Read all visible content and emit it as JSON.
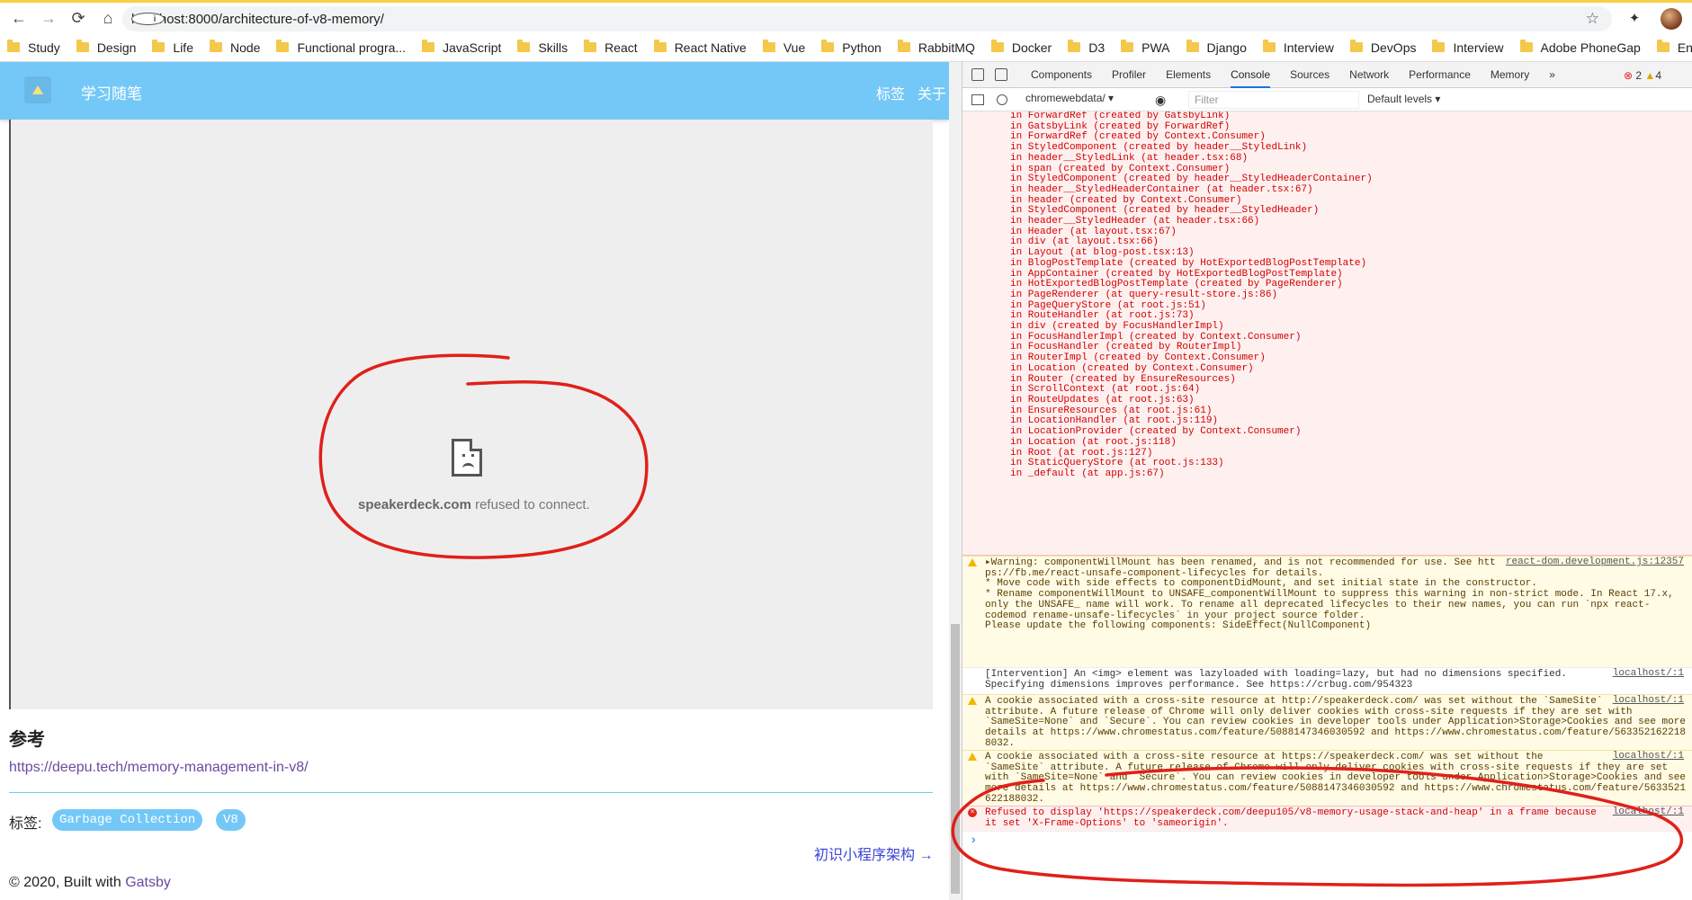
{
  "browser": {
    "url": "localhost:8000/architecture-of-v8-memory/",
    "nav_icons": [
      "back-arrow-icon",
      "forward-arrow-icon",
      "reload-icon",
      "home-icon"
    ],
    "bookmarks": [
      "Study",
      "Design",
      "Life",
      "Node",
      "Functional progra...",
      "JavaScript",
      "Skills",
      "React",
      "React Native",
      "Vue",
      "Python",
      "RabbitMQ",
      "Docker",
      "D3",
      "PWA",
      "Django",
      "Interview",
      "DevOps",
      "Interview",
      "Adobe PhoneGap",
      "Enterprise"
    ]
  },
  "site": {
    "title": "学习随笔",
    "nav": [
      "标签",
      "关于"
    ],
    "iframe_error": {
      "domain": "speakerdeck.com",
      "message": "refused to connect."
    },
    "references_heading": "参考",
    "reference_link": "https://deepu.tech/memory-management-in-v8/",
    "tags_label": "标签:",
    "tags": [
      "Garbage Collection",
      "V8"
    ],
    "next_post": "初识小程序架构 →",
    "footer_prefix": "© 2020, Built with ",
    "footer_link": "Gatsby"
  },
  "devtools": {
    "tabs": [
      "Components",
      "Profiler",
      "Elements",
      "Console",
      "Sources",
      "Network",
      "Performance",
      "Memory",
      "»"
    ],
    "active_tab": "Console",
    "error_count": "2",
    "warning_count": "4",
    "context": "chromewebdata/",
    "filter_placeholder": "Filter",
    "levels": "Default levels ▾",
    "stack": [
      "in ForwardRef (created by GatsbyLink)",
      "in GatsbyLink (created by ForwardRef)",
      "in ForwardRef (created by Context.Consumer)",
      "in StyledComponent (created by header__StyledLink)",
      "in header__StyledLink (at header.tsx:68)",
      "in span (created by Context.Consumer)",
      "in StyledComponent (created by header__StyledHeaderContainer)",
      "in header__StyledHeaderContainer (at header.tsx:67)",
      "in header (created by Context.Consumer)",
      "in StyledComponent (created by header__StyledHeader)",
      "in header__StyledHeader (at header.tsx:66)",
      "in Header (at layout.tsx:67)",
      "in div (at layout.tsx:66)",
      "in Layout (at blog-post.tsx:13)",
      "in BlogPostTemplate (created by HotExportedBlogPostTemplate)",
      "in AppContainer (created by HotExportedBlogPostTemplate)",
      "in HotExportedBlogPostTemplate (created by PageRenderer)",
      "in PageRenderer (at query-result-store.js:86)",
      "in PageQueryStore (at root.js:51)",
      "in RouteHandler (at root.js:73)",
      "in div (created by FocusHandlerImpl)",
      "in FocusHandlerImpl (created by Context.Consumer)",
      "in FocusHandler (created by RouterImpl)",
      "in RouterImpl (created by Context.Consumer)",
      "in Location (created by Context.Consumer)",
      "in Router (created by EnsureResources)",
      "in ScrollContext (at root.js:64)",
      "in RouteUpdates (at root.js:63)",
      "in EnsureResources (at root.js:61)",
      "in LocationHandler (at root.js:119)",
      "in LocationProvider (created by Context.Consumer)",
      "in Location (at root.js:118)",
      "in Root (at root.js:127)",
      "in StaticQueryStore (at root.js:133)",
      "in _default (at app.js:67)"
    ],
    "warning1": {
      "source": "react-dom.development.js:12357",
      "lines": [
        "▸Warning: componentWillMount has been renamed, and is not recommended for use. See htt",
        "ps://fb.me/react-unsafe-component-lifecycles for details.",
        "",
        "* Move code with side effects to componentDidMount, and set initial state in the constructor.",
        "* Rename componentWillMount to UNSAFE_componentWillMount to suppress this warning in non-strict mode. In React 17.x,",
        "only the UNSAFE_ name will work. To rename all deprecated lifecycles to their new names, you can run `npx react-",
        "codemod rename-unsafe-lifecycles` in your project source folder.",
        "",
        "Please update the following components: SideEffect(NullComponent)"
      ]
    },
    "intervention": {
      "source": "localhost/:1",
      "lines": [
        "[Intervention] An <img> element was lazyloaded with loading=lazy, but had no dimensions specified.",
        "Specifying dimensions improves performance. See https://crbug.com/954323"
      ]
    },
    "cookie1": {
      "source": "localhost/:1",
      "lines": [
        "A cookie associated with a cross-site resource at http://speakerdeck.com/ was set without the `SameSite`",
        "attribute. A future release of Chrome will only deliver cookies with cross-site requests if they are set with",
        "`SameSite=None` and `Secure`. You can review cookies in developer tools under Application>Storage>Cookies and see more",
        "details at https://www.chromestatus.com/feature/5088147346030592 and https://www.chromestatus.com/feature/563352162218",
        "8032."
      ]
    },
    "cookie2": {
      "source": "localhost/:1",
      "lines": [
        "A cookie associated with a cross-site resource at https://speakerdeck.com/ was set without the",
        "`SameSite` attribute. A future release of Chrome will only deliver cookies with cross-site requests if they are set",
        "with `SameSite=None` and `Secure`. You can review cookies in developer tools under Application>Storage>Cookies and see",
        "more details at https://www.chromestatus.com/feature/5088147346030592 and https://www.chromestatus.com/feature/5633521",
        "622188032."
      ]
    },
    "error": {
      "source": "localhost/:1",
      "lines": [
        "Refused to display 'https://speakerdeck.com/deepu105/v8-memory-usage-stack-and-heap' in a frame because",
        "it set 'X-Frame-Options' to 'sameorigin'."
      ]
    }
  },
  "colors": {
    "header": "#74c8f7",
    "annotation": "#e0201a",
    "error_text": "#d10000"
  }
}
